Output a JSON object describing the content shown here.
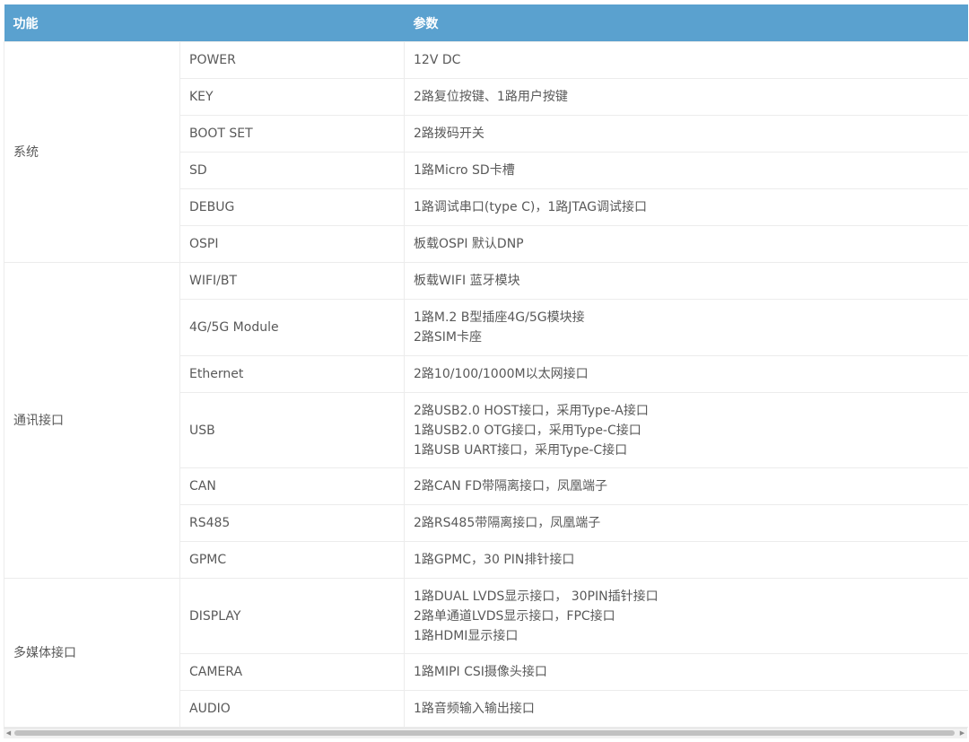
{
  "header": {
    "col_function": "功能",
    "col_params": "参数"
  },
  "groups": [
    {
      "name": "系统",
      "rows": [
        {
          "item": "POWER",
          "value": "12V DC"
        },
        {
          "item": "KEY",
          "value": "2路复位按键、1路用户按键"
        },
        {
          "item": "BOOT SET",
          "value": "2路拨码开关"
        },
        {
          "item": "SD",
          "value": "1路Micro SD卡槽"
        },
        {
          "item": "DEBUG",
          "value": "1路调试串口(type C)，1路JTAG调试接口"
        },
        {
          "item": "OSPI",
          "value": "板载OSPI 默认DNP"
        }
      ]
    },
    {
      "name": "通讯接口",
      "rows": [
        {
          "item": "WIFI/BT",
          "value": "板载WIFI 蓝牙模块"
        },
        {
          "item": "4G/5G Module",
          "lines": [
            "1路M.2 B型插座4G/5G模块接",
            "2路SIM卡座"
          ]
        },
        {
          "item": "Ethernet",
          "value": "2路10/100/1000M以太网接口"
        },
        {
          "item": "USB",
          "lines": [
            "2路USB2.0 HOST接口，采用Type-A接口",
            "1路USB2.0 OTG接口，采用Type-C接口",
            "1路USB UART接口，采用Type-C接口"
          ]
        },
        {
          "item": "CAN",
          "value": "2路CAN FD带隔离接口，凤凰端子"
        },
        {
          "item": "RS485",
          "value": "2路RS485带隔离接口，凤凰端子"
        },
        {
          "item": "GPMC",
          "value": "1路GPMC，30 PIN排针接口"
        }
      ]
    },
    {
      "name": "多媒体接口",
      "rows": [
        {
          "item": "DISPLAY",
          "lines": [
            "1路DUAL LVDS显示接口， 30PIN插针接口",
            "2路单通道LVDS显示接口，FPC接口",
            "1路HDMI显示接口"
          ]
        },
        {
          "item": "CAMERA",
          "value": "1路MIPI CSI摄像头接口"
        },
        {
          "item": "AUDIO",
          "value": "1路音频输入输出接口"
        }
      ]
    }
  ],
  "scrollbar": {
    "left_arrow": "◀",
    "right_arrow": "▶"
  }
}
